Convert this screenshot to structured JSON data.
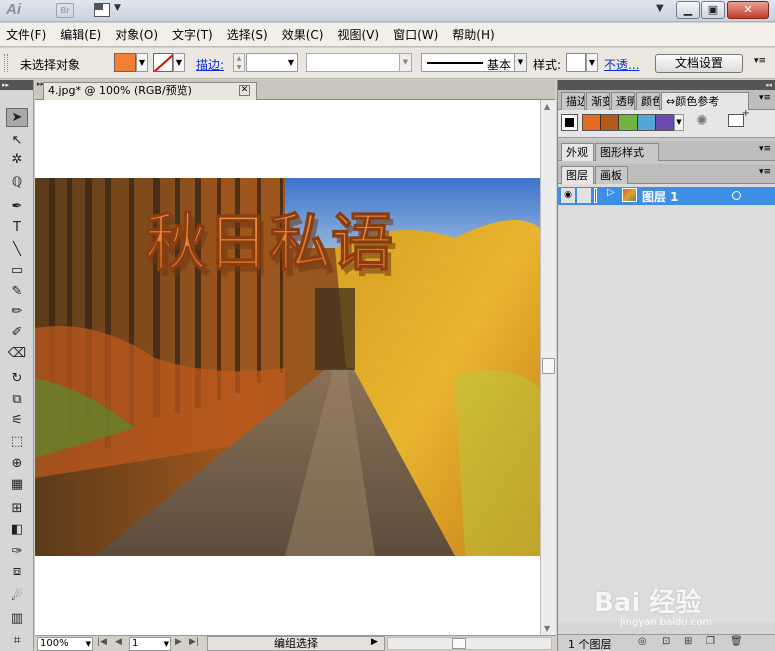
{
  "titlebar": {
    "app_logo": "Ai",
    "bridge_label": "Br",
    "window_buttons": {
      "minimize": "▁",
      "maximize": "▣",
      "close": "✕"
    }
  },
  "menu": [
    "文件(F)",
    "编辑(E)",
    "对象(O)",
    "文字(T)",
    "选择(S)",
    "效果(C)",
    "视图(V)",
    "窗口(W)",
    "帮助(H)"
  ],
  "control_bar": {
    "selection_label": "未选择对象",
    "fill_color": "#f47f30",
    "stroke_link": "描边:",
    "brush_label": "基本",
    "style_label": "样式:",
    "opacity_link": "不透...",
    "document_setup_button": "文档设置"
  },
  "document": {
    "tab_title": "4.jpg* @ 100% (RGB/预览)",
    "artwork_text": "秋日私语"
  },
  "statusbar": {
    "zoom": "100%",
    "page": "1",
    "status_text": "编组选择"
  },
  "panels": {
    "top_tabs": [
      "描边",
      "渐变",
      "透明",
      "颜色",
      "颜色参考"
    ],
    "appearance_tabs": [
      "外观",
      "图形样式"
    ],
    "layers_tabs": [
      "图层",
      "画板"
    ],
    "color_guide_swatches": [
      "#e36b1f",
      "#b55a1a",
      "#71b33b",
      "#4fa7d8",
      "#6e4bb0"
    ],
    "layer": {
      "name": "图层 1"
    },
    "layer_count": "1 个图层"
  },
  "watermark": {
    "text": "Bai 经验",
    "url": "jingyan.baidu.com"
  }
}
